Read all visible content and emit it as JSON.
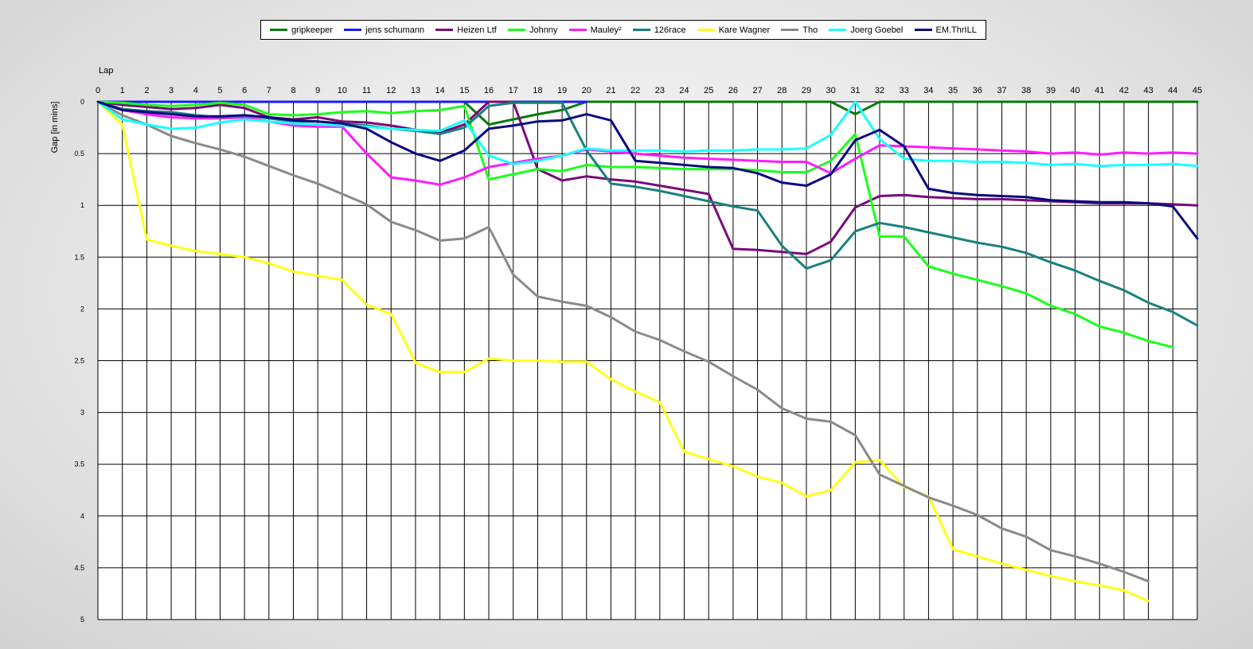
{
  "chart_data": {
    "type": "line",
    "xlabel": "Lap",
    "ylabel": "Gap [in mins]",
    "xlim": [
      0,
      45
    ],
    "ylim": [
      0,
      5
    ],
    "y_ticks": [
      "0",
      "0.5",
      "1",
      "1.5",
      "2",
      "2.5",
      "3",
      "3.5",
      "4",
      "4.5",
      "5"
    ],
    "y_inverted": true,
    "grid": true,
    "legend_position": "top",
    "x": [
      0,
      1,
      2,
      3,
      4,
      5,
      6,
      7,
      8,
      9,
      10,
      11,
      12,
      13,
      14,
      15,
      16,
      17,
      18,
      19,
      20,
      21,
      22,
      23,
      24,
      25,
      26,
      27,
      28,
      29,
      30,
      31,
      32,
      33,
      34,
      35,
      36,
      37,
      38,
      39,
      40,
      41,
      42,
      43,
      44,
      45
    ],
    "series": [
      {
        "name": "gripkeeper",
        "color": "#0a7a0a",
        "values": [
          0,
          0,
          0,
          0,
          0,
          0,
          0,
          0,
          0,
          0,
          0,
          0,
          0,
          0,
          0,
          0,
          0.22,
          0.17,
          0.12,
          0.08,
          0,
          0,
          0,
          0,
          0,
          0,
          0,
          0,
          0,
          0,
          0,
          0.12,
          0,
          0,
          0,
          0,
          0,
          0,
          0,
          0,
          0,
          0,
          0,
          0,
          0,
          0
        ]
      },
      {
        "name": "jens  schumann",
        "color": "#1a1aff",
        "values": [
          0,
          0,
          0,
          0,
          0,
          0,
          0,
          0,
          0,
          0,
          0,
          0,
          0,
          0,
          0,
          0,
          0,
          0,
          0,
          0,
          0,
          null,
          null,
          null,
          null,
          null,
          null,
          null,
          null,
          null,
          null,
          null,
          null,
          null,
          null,
          null,
          null,
          null,
          null,
          null,
          null,
          null,
          null,
          null,
          null,
          null
        ]
      },
      {
        "name": "Heizen Ltf",
        "color": "#7a0a7a",
        "values": [
          0,
          0.03,
          0.05,
          0.07,
          0.06,
          0.03,
          0.06,
          0.15,
          0.17,
          0.15,
          0.19,
          0.2,
          0.23,
          0.27,
          0.3,
          0.22,
          0,
          0,
          0.65,
          0.76,
          0.72,
          0.75,
          0.77,
          0.81,
          0.85,
          0.89,
          1.42,
          1.43,
          1.45,
          1.47,
          1.35,
          1.02,
          0.91,
          0.9,
          0.92,
          0.93,
          0.94,
          0.94,
          0.95,
          0.96,
          0.97,
          0.98,
          0.98,
          0.98,
          0.99,
          1.0
        ]
      },
      {
        "name": "Johnny",
        "color": "#1aff1a",
        "values": [
          0,
          0.01,
          0.03,
          0.04,
          0.03,
          0.01,
          0.03,
          0.12,
          0.13,
          0.12,
          0.1,
          0.09,
          0.11,
          0.09,
          0.08,
          0.04,
          0.75,
          0.7,
          0.65,
          0.67,
          0.61,
          0.63,
          0.63,
          0.64,
          0.65,
          0.65,
          0.65,
          0.66,
          0.68,
          0.68,
          0.57,
          0.31,
          1.3,
          1.3,
          1.59,
          1.66,
          1.72,
          1.78,
          1.85,
          1.97,
          2.05,
          2.17,
          2.23,
          2.31,
          2.37,
          null
        ]
      },
      {
        "name": "Mauley²",
        "color": "#ff1aff",
        "values": [
          0,
          0.08,
          0.12,
          0.15,
          0.16,
          0.16,
          0.15,
          0.19,
          0.23,
          0.24,
          0.24,
          0.5,
          0.73,
          0.76,
          0.8,
          0.73,
          0.63,
          0.59,
          0.55,
          0.52,
          0.46,
          0.48,
          0.5,
          0.52,
          0.54,
          0.55,
          0.56,
          0.57,
          0.58,
          0.58,
          0.69,
          0.55,
          0.42,
          0.43,
          0.44,
          0.45,
          0.46,
          0.47,
          0.48,
          0.5,
          0.49,
          0.51,
          0.49,
          0.5,
          0.49,
          0.5
        ]
      },
      {
        "name": "126race",
        "color": "#1a8080",
        "values": [
          0,
          0.07,
          0.09,
          0.1,
          0.13,
          0.15,
          0.13,
          0.16,
          0.19,
          0.19,
          0.21,
          0.23,
          0.26,
          0.28,
          0.31,
          0.25,
          0.04,
          0.01,
          0.01,
          0.01,
          0.47,
          0.79,
          0.82,
          0.86,
          0.91,
          0.96,
          1.01,
          1.05,
          1.39,
          1.61,
          1.53,
          1.25,
          1.17,
          1.21,
          1.26,
          1.31,
          1.36,
          1.4,
          1.46,
          1.55,
          1.63,
          1.73,
          1.82,
          1.94,
          2.03,
          2.16
        ]
      },
      {
        "name": "Kare Wagner",
        "color": "#ffff1a",
        "values": [
          0,
          0.22,
          1.33,
          1.39,
          1.44,
          1.47,
          1.5,
          1.56,
          1.64,
          1.68,
          1.72,
          1.96,
          2.05,
          2.52,
          2.61,
          2.61,
          2.48,
          2.5,
          2.5,
          2.51,
          2.51,
          2.68,
          2.8,
          2.9,
          3.38,
          3.45,
          3.52,
          3.62,
          3.68,
          3.81,
          3.75,
          3.48,
          3.46,
          3.72,
          3.81,
          4.32,
          4.39,
          4.46,
          4.52,
          4.58,
          4.63,
          4.67,
          4.72,
          4.82,
          null,
          null
        ]
      },
      {
        "name": "Tho",
        "color": "#8a8a8a",
        "values": [
          0,
          0.13,
          0.22,
          0.33,
          0.4,
          0.46,
          0.53,
          0.62,
          0.71,
          0.79,
          0.89,
          0.99,
          1.16,
          1.24,
          1.34,
          1.32,
          1.21,
          1.67,
          1.88,
          1.93,
          1.97,
          2.08,
          2.22,
          2.3,
          2.41,
          2.51,
          2.65,
          2.78,
          2.96,
          3.06,
          3.09,
          3.22,
          3.6,
          3.71,
          3.82,
          3.9,
          3.99,
          4.12,
          4.2,
          4.33,
          4.39,
          4.46,
          4.54,
          4.63,
          null,
          null
        ]
      },
      {
        "name": "Joerg Goebel",
        "color": "#1affff",
        "values": [
          0,
          0.17,
          0.22,
          0.26,
          0.25,
          0.2,
          0.17,
          0.19,
          0.21,
          0.22,
          0.23,
          0.24,
          0.26,
          0.27,
          0.28,
          0.18,
          0.52,
          0.6,
          0.57,
          0.52,
          0.45,
          0.47,
          0.47,
          0.47,
          0.48,
          0.47,
          0.47,
          0.46,
          0.46,
          0.45,
          0.32,
          0,
          0.36,
          0.55,
          0.57,
          0.57,
          0.58,
          0.58,
          0.59,
          0.61,
          0.6,
          0.62,
          0.61,
          0.61,
          0.6,
          0.62
        ]
      },
      {
        "name": "EM.ThrILL",
        "color": "#0a0a80",
        "values": [
          0,
          0.08,
          0.1,
          0.12,
          0.14,
          0.14,
          0.13,
          0.15,
          0.18,
          0.19,
          0.21,
          0.26,
          0.39,
          0.5,
          0.57,
          0.47,
          0.26,
          0.23,
          0.19,
          0.18,
          0.12,
          0.18,
          0.57,
          0.59,
          0.61,
          0.63,
          0.64,
          0.69,
          0.78,
          0.81,
          0.7,
          0.37,
          0.27,
          0.43,
          0.84,
          0.88,
          0.9,
          0.91,
          0.92,
          0.95,
          0.96,
          0.97,
          0.97,
          0.98,
          1.01,
          1.32
        ]
      }
    ]
  }
}
